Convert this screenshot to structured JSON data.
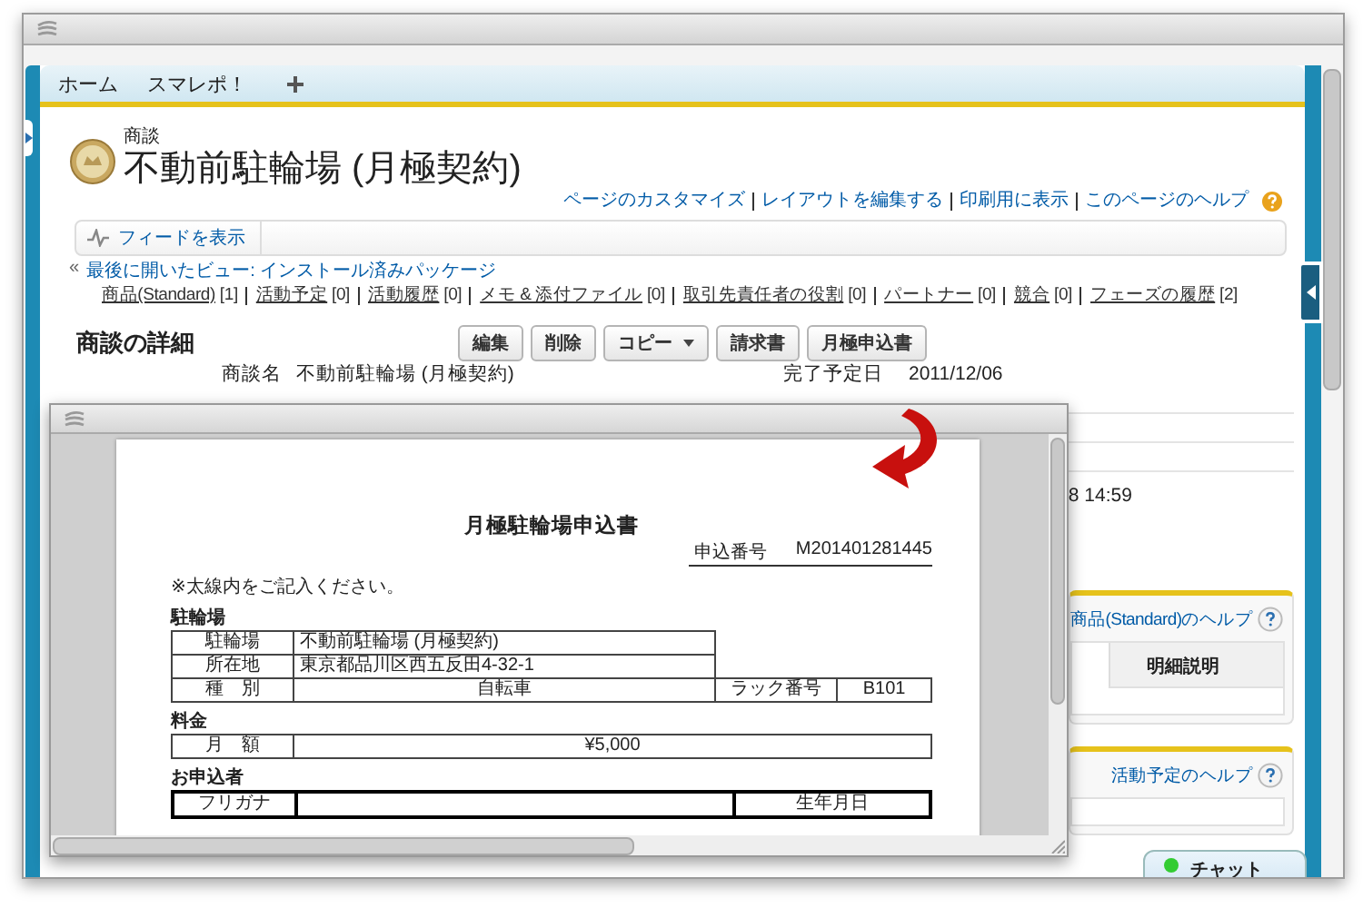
{
  "nav_tabs": [
    {
      "label": "ホーム",
      "selected": false
    },
    {
      "label": "スマレポ！",
      "selected": false
    }
  ],
  "record": {
    "object_type": "商談",
    "title": "不動前駐輪場 (月極契約)"
  },
  "header_links": [
    "ページのカスタマイズ",
    "レイアウトを編集する",
    "印刷用に表示",
    "このページのヘルプ"
  ],
  "feed_button": "フィードを表示",
  "breadcrumb": {
    "prefix": "«",
    "link": "最後に開いたビュー: インストール済みパッケージ"
  },
  "related_lists": [
    {
      "label": "商品(Standard)",
      "count": "[1]"
    },
    {
      "label": "活動予定",
      "count": "[0]"
    },
    {
      "label": "活動履歴",
      "count": "[0]"
    },
    {
      "label": "メモ & 添付ファイル",
      "count": "[0]"
    },
    {
      "label": "取引先責任者の役割",
      "count": "[0]"
    },
    {
      "label": "パートナー",
      "count": "[0]"
    },
    {
      "label": "競合",
      "count": "[0]"
    },
    {
      "label": "フェーズの履歴",
      "count": "[2]"
    }
  ],
  "detail": {
    "heading": "商談の詳細",
    "buttons": [
      {
        "label": "編集",
        "kind": "plain"
      },
      {
        "label": "削除",
        "kind": "plain"
      },
      {
        "label": "コピー",
        "kind": "dropdown"
      },
      {
        "label": "請求書",
        "kind": "plain"
      },
      {
        "label": "月極申込書",
        "kind": "plain"
      }
    ],
    "fields": [
      {
        "label": "商談名",
        "value": "不動前駐輪場 (月極契約)"
      },
      {
        "label": "完了予定日",
        "value": "2011/12/06"
      }
    ],
    "partial_value": "8 14:59"
  },
  "panels": [
    {
      "help_link": "商品(Standard)のヘルプ",
      "columns": [
        "明細説明"
      ]
    },
    {
      "help_link": "活動予定のヘルプ"
    }
  ],
  "chat": {
    "label": "チャット"
  },
  "popup": {
    "title": "月極駐輪場申込書",
    "number_label": "申込番号",
    "number": "M201401281445",
    "note": "※太線内をご記入ください。",
    "sections": [
      {
        "heading": "駐輪場",
        "bold": false,
        "rows": [
          [
            "駐輪場",
            "不動前駐輪場 (月極契約)"
          ],
          [
            "所在地",
            "東京都品川区西五反田4-32-1"
          ],
          [
            "種　別",
            "自転車",
            "ラック番号",
            "B101"
          ]
        ]
      },
      {
        "heading": "料金",
        "bold": false,
        "rows": [
          [
            "月　額",
            "¥5,000"
          ]
        ]
      },
      {
        "heading": "お申込者",
        "bold": true,
        "rows": [
          [
            "フリガナ",
            "",
            "生年月日"
          ]
        ]
      }
    ]
  }
}
